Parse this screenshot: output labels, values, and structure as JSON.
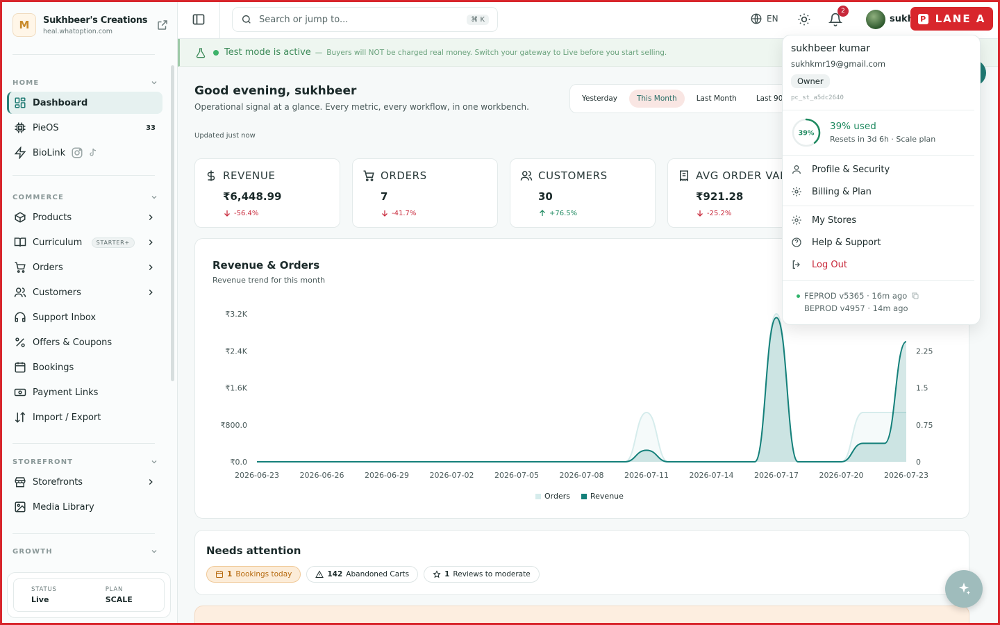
{
  "brand": {
    "name": "Sukhbeer's Creations",
    "url": "heal.whatoption.com",
    "logo_letter": "M"
  },
  "sidebar": {
    "sections": {
      "home": "HOME",
      "commerce": "COMMERCE",
      "storefront": "STOREFRONT",
      "growth": "GROWTH"
    },
    "items": {
      "dashboard": "Dashboard",
      "pieos": "PieOS",
      "pieos_count": "33",
      "biolink": "BioLink",
      "products": "Products",
      "curriculum": "Curriculum",
      "curriculum_badge": "STARTER+",
      "orders": "Orders",
      "customers": "Customers",
      "support": "Support Inbox",
      "offers": "Offers & Coupons",
      "bookings": "Bookings",
      "payment_links": "Payment Links",
      "import_export": "Import / Export",
      "storefronts": "Storefronts",
      "media": "Media Library"
    },
    "status": {
      "status_label": "STATUS",
      "status_value": "Live",
      "plan_label": "PLAN",
      "plan_value": "SCALE"
    }
  },
  "topbar": {
    "search_placeholder": "Search or jump to...",
    "shortcut": "⌘ K",
    "lang": "EN",
    "notifications": "2",
    "user_short": "sukh",
    "lane_label": "LANE A",
    "lane_icon": "P"
  },
  "banner": {
    "title": "Test mode is active",
    "dash": "—",
    "message": "Buyers will NOT be charged real money. Switch your gateway to Live before you start selling."
  },
  "greeting": {
    "title": "Good evening, sukhbeer",
    "subtitle": "Operational signal at a glance. Every metric, every workflow, in one workbench.",
    "updated": "Updated just now"
  },
  "ranges": [
    "Yesterday",
    "This Month",
    "Last Month",
    "Last 90 D"
  ],
  "selected_range": "This Month",
  "kpis": [
    {
      "label": "REVENUE",
      "value": "₹6,448.99",
      "delta": "-56.4%",
      "direction": "down",
      "icon": "dollar-icon"
    },
    {
      "label": "ORDERS",
      "value": "7",
      "delta": "-41.7%",
      "direction": "down",
      "icon": "cart-icon"
    },
    {
      "label": "CUSTOMERS",
      "value": "30",
      "delta": "+76.5%",
      "direction": "up",
      "icon": "users-icon"
    },
    {
      "label": "AVG ORDER VAL",
      "value": "₹921.28",
      "delta": "-25.2%",
      "direction": "down",
      "icon": "receipt-icon"
    }
  ],
  "chart": {
    "title": "Revenue & Orders",
    "subtitle": "Revenue trend for this month"
  },
  "chart_data": {
    "type": "area",
    "x": [
      "2026-06-23",
      "2026-06-24",
      "2026-06-25",
      "2026-06-26",
      "2026-06-27",
      "2026-06-28",
      "2026-06-29",
      "2026-06-30",
      "2026-07-01",
      "2026-07-02",
      "2026-07-03",
      "2026-07-04",
      "2026-07-05",
      "2026-07-06",
      "2026-07-07",
      "2026-07-08",
      "2026-07-09",
      "2026-07-10",
      "2026-07-11",
      "2026-07-12",
      "2026-07-13",
      "2026-07-14",
      "2026-07-15",
      "2026-07-16",
      "2026-07-17",
      "2026-07-18",
      "2026-07-19",
      "2026-07-20",
      "2026-07-21",
      "2026-07-22",
      "2026-07-23"
    ],
    "x_ticks": [
      "2026-06-23",
      "2026-06-26",
      "2026-06-29",
      "2026-07-02",
      "2026-07-05",
      "2026-07-08",
      "2026-07-11",
      "2026-07-14",
      "2026-07-17",
      "2026-07-20",
      "2026-07-23"
    ],
    "series": [
      {
        "name": "Orders",
        "axis": "right",
        "color": "#d6ecec",
        "values": [
          0,
          0,
          0,
          0,
          0,
          0,
          0,
          0,
          0,
          0,
          0,
          0,
          0,
          0,
          0,
          0,
          0,
          0,
          1,
          0,
          0,
          0,
          0,
          0,
          3,
          0,
          0,
          0,
          1,
          1,
          1
        ]
      },
      {
        "name": "Revenue",
        "axis": "left",
        "color": "#14807a",
        "values": [
          0,
          0,
          0,
          0,
          0,
          0,
          0,
          0,
          0,
          0,
          0,
          0,
          0,
          0,
          0,
          0,
          0,
          0,
          250,
          0,
          0,
          0,
          0,
          0,
          3120,
          0,
          0,
          0,
          400,
          400,
          2600
        ]
      }
    ],
    "y_left": {
      "ticks": [
        "₹0.0",
        "₹800.0",
        "₹1.6K",
        "₹2.4K",
        "₹3.2K"
      ],
      "range": [
        0,
        3200
      ]
    },
    "y_right": {
      "ticks": [
        "0",
        "0.75",
        "1.5",
        "2.25"
      ],
      "range": [
        0,
        3
      ]
    },
    "legend_position": "bottom-center"
  },
  "attention": {
    "title": "Needs attention",
    "chips": [
      {
        "count": "1",
        "label": "Bookings today",
        "icon": "calendar-icon"
      },
      {
        "count": "142",
        "label": "Abandoned Carts",
        "icon": "warning-icon"
      },
      {
        "count": "1",
        "label": "Reviews to moderate",
        "icon": "star-icon"
      }
    ]
  },
  "menu": {
    "name": "sukhbeer kumar",
    "email": "sukhkmr19@gmail.com",
    "role": "Owner",
    "store_id": "pc_st_a5dc2640",
    "usage_percent": 39,
    "usage_label": "39%",
    "usage_title": "39% used",
    "usage_sub": "Resets in 3d 6h · Scale plan",
    "items": {
      "profile": "Profile & Security",
      "billing": "Billing & Plan",
      "stores": "My Stores",
      "help": "Help & Support",
      "logout": "Log Out"
    },
    "versions": [
      "FEPROD v5365 · 16m ago",
      "BEPROD v4957 · 14m ago"
    ]
  },
  "colors": {
    "accent": "#1f7a73",
    "danger": "#c8283a",
    "positive": "#1f8a60",
    "lane": "#d8262c"
  }
}
